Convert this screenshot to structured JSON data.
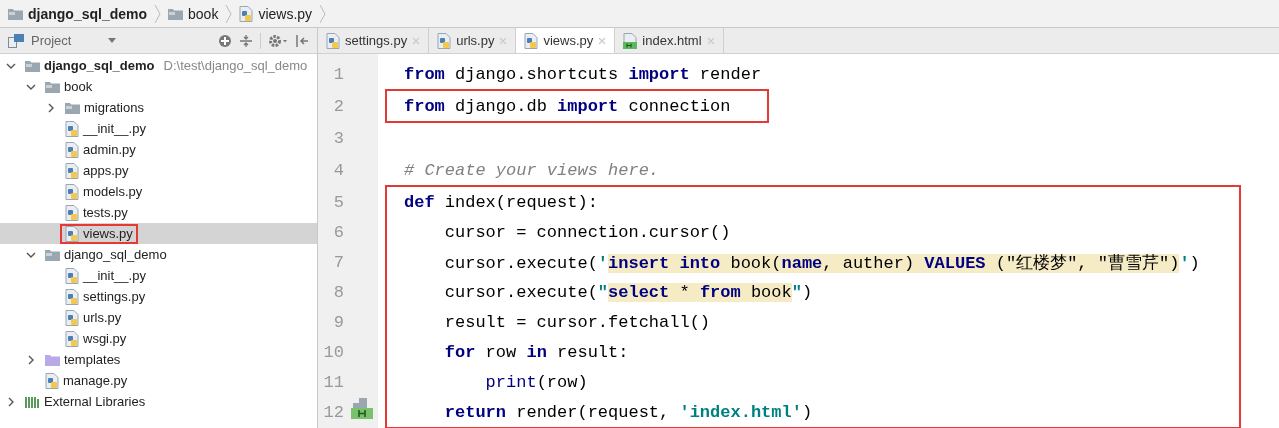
{
  "breadcrumbs": [
    {
      "label": "django_sql_demo",
      "kind": "folder"
    },
    {
      "label": "book",
      "kind": "folder"
    },
    {
      "label": "views.py",
      "kind": "python"
    }
  ],
  "project_panel": {
    "title": "Project"
  },
  "tree": [
    {
      "label": "django_sql_demo",
      "path": "D:\\test\\django_sql_demo",
      "kind": "folder",
      "expanded": true,
      "selected": false,
      "marked": false,
      "children": [
        {
          "label": "book",
          "kind": "folder",
          "expanded": true,
          "selected": false,
          "marked": false,
          "children": [
            {
              "label": "migrations",
              "kind": "folder",
              "expanded": false,
              "selected": false,
              "marked": false
            },
            {
              "label": "__init__.py",
              "kind": "python",
              "selected": false,
              "marked": false
            },
            {
              "label": "admin.py",
              "kind": "python",
              "selected": false,
              "marked": false
            },
            {
              "label": "apps.py",
              "kind": "python",
              "selected": false,
              "marked": false
            },
            {
              "label": "models.py",
              "kind": "python",
              "selected": false,
              "marked": false
            },
            {
              "label": "tests.py",
              "kind": "python",
              "selected": false,
              "marked": false
            },
            {
              "label": "views.py",
              "kind": "python",
              "selected": true,
              "marked": true
            }
          ]
        },
        {
          "label": "django_sql_demo",
          "kind": "folder",
          "expanded": true,
          "selected": false,
          "marked": false,
          "children": [
            {
              "label": "__init__.py",
              "kind": "python",
              "selected": false,
              "marked": false
            },
            {
              "label": "settings.py",
              "kind": "python",
              "selected": false,
              "marked": false
            },
            {
              "label": "urls.py",
              "kind": "python",
              "selected": false,
              "marked": false
            },
            {
              "label": "wsgi.py",
              "kind": "python",
              "selected": false,
              "marked": false
            }
          ]
        },
        {
          "label": "templates",
          "kind": "template-folder",
          "expanded": false,
          "selected": false,
          "marked": false
        },
        {
          "label": "manage.py",
          "kind": "python",
          "selected": false,
          "marked": false
        }
      ]
    },
    {
      "label": "External Libraries",
      "kind": "libraries",
      "expanded": false,
      "selected": false,
      "marked": false
    }
  ],
  "tabs": [
    {
      "label": "settings.py",
      "kind": "python",
      "selected": false
    },
    {
      "label": "urls.py",
      "kind": "python",
      "selected": false
    },
    {
      "label": "views.py",
      "kind": "python",
      "selected": true
    },
    {
      "label": "index.html",
      "kind": "html",
      "selected": false
    }
  ],
  "code_lines": [
    {
      "number": "1",
      "marked": false,
      "linked": false,
      "tokens": [
        {
          "kind": "kw",
          "text": "from"
        },
        {
          "kind": "plain",
          "text": " django.shortcuts "
        },
        {
          "kind": "kw",
          "text": "import"
        },
        {
          "kind": "plain",
          "text": " render"
        }
      ]
    },
    {
      "number": "2",
      "marked": true,
      "linked": false,
      "tokens": [
        {
          "kind": "kw",
          "text": "from"
        },
        {
          "kind": "plain",
          "text": " django.db "
        },
        {
          "kind": "kw",
          "text": "import"
        },
        {
          "kind": "plain",
          "text": " connection"
        }
      ]
    },
    {
      "number": "3",
      "marked": false,
      "linked": false
    },
    {
      "number": "4",
      "marked": false,
      "linked": false,
      "tokens": [
        {
          "kind": "comment",
          "text": "# Create your views here."
        }
      ]
    },
    {
      "number": "5",
      "marked": true,
      "linked": false,
      "tokens": [
        {
          "kind": "kw",
          "text": "def"
        },
        {
          "kind": "plain",
          "text": " index(request):"
        }
      ]
    },
    {
      "number": "6",
      "marked": true,
      "linked": false,
      "tokens": [
        {
          "kind": "plain",
          "text": "    cursor = connection.cursor()"
        }
      ]
    },
    {
      "number": "7",
      "marked": true,
      "linked": false,
      "tokens": [
        {
          "kind": "plain",
          "text": "    cursor.execute("
        },
        {
          "kind": "str",
          "text": "'"
        },
        {
          "kind": "sqlkw",
          "text": "insert into"
        },
        {
          "kind": "sql",
          "text": " book("
        },
        {
          "kind": "sqlkw",
          "text": "name"
        },
        {
          "kind": "sql",
          "text": ", auther) "
        },
        {
          "kind": "sqlkw",
          "text": "VALUES"
        },
        {
          "kind": "sql",
          "text": " (\"红楼梦\", \"曹雪芹\")"
        },
        {
          "kind": "str",
          "text": "'"
        },
        {
          "kind": "plain",
          "text": ")"
        }
      ]
    },
    {
      "number": "8",
      "marked": true,
      "linked": false,
      "tokens": [
        {
          "kind": "plain",
          "text": "    cursor.execute("
        },
        {
          "kind": "str",
          "text": "\""
        },
        {
          "kind": "sqlkw",
          "text": "select"
        },
        {
          "kind": "sql",
          "text": " * "
        },
        {
          "kind": "sqlkw",
          "text": "from"
        },
        {
          "kind": "sql",
          "text": " book"
        },
        {
          "kind": "str",
          "text": "\""
        },
        {
          "kind": "plain",
          "text": ")"
        }
      ]
    },
    {
      "number": "9",
      "marked": true,
      "linked": false,
      "tokens": [
        {
          "kind": "plain",
          "text": "    result = cursor.fetchall()"
        }
      ]
    },
    {
      "number": "10",
      "marked": true,
      "linked": false,
      "tokens": [
        {
          "kind": "kw",
          "text": "    for"
        },
        {
          "kind": "plain",
          "text": " row "
        },
        {
          "kind": "kw",
          "text": "in"
        },
        {
          "kind": "plain",
          "text": " result:"
        }
      ]
    },
    {
      "number": "11",
      "marked": true,
      "linked": false,
      "tokens": [
        {
          "kind": "builtin",
          "text": "        print"
        },
        {
          "kind": "plain",
          "text": "(row)"
        }
      ]
    },
    {
      "number": "12",
      "marked": true,
      "linked": true,
      "tokens": [
        {
          "kind": "kw",
          "text": "    return"
        },
        {
          "kind": "plain",
          "text": " render(request, "
        },
        {
          "kind": "str",
          "text": "'index.html'"
        },
        {
          "kind": "plain",
          "text": ")"
        }
      ]
    }
  ]
}
